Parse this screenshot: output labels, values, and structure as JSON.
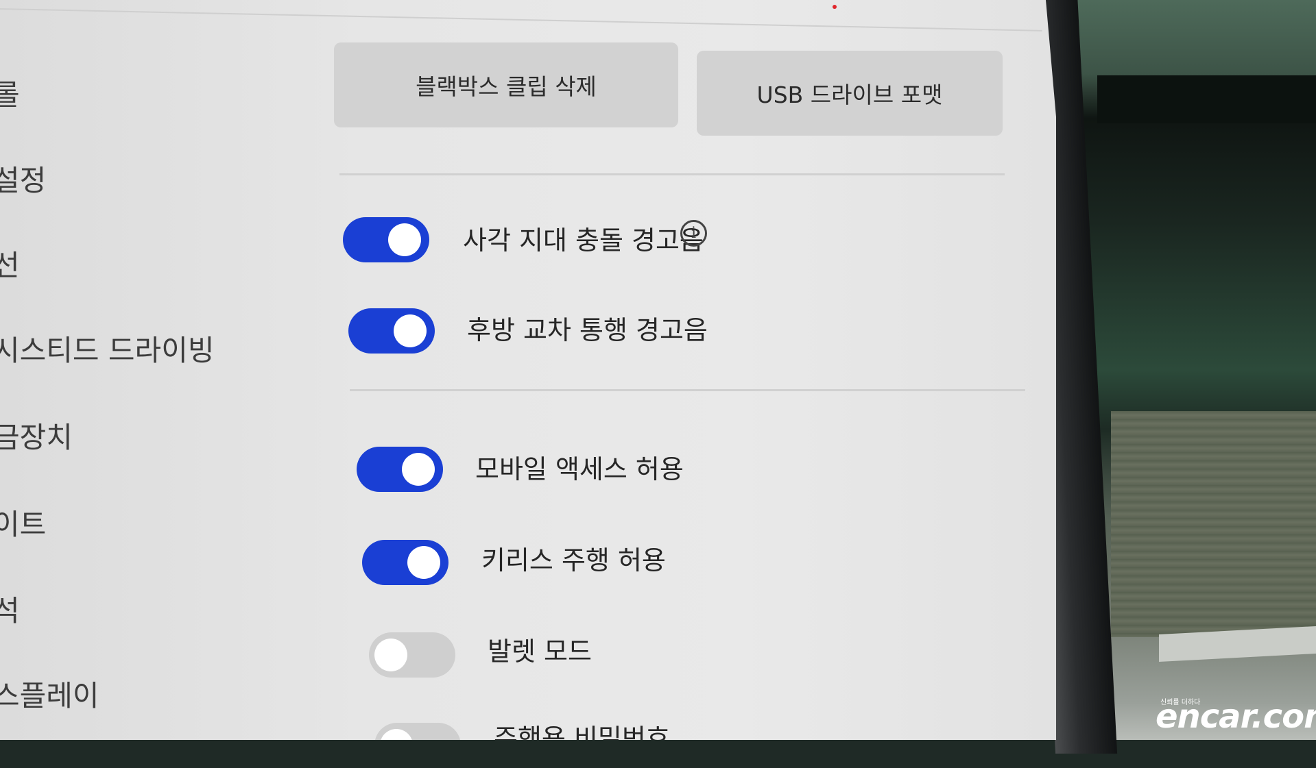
{
  "sidebar": {
    "items": [
      {
        "label": "롤"
      },
      {
        "label": "설정"
      },
      {
        "label": "선"
      },
      {
        "label": "시스티드 드라이빙"
      },
      {
        "label": "금장치"
      },
      {
        "label": "이트"
      },
      {
        "label": "석"
      },
      {
        "label": "스플레이"
      }
    ]
  },
  "actions": {
    "clip_delete": "블랙박스 클립 삭제",
    "usb_format": "USB 드라이브 포맷"
  },
  "toggles": [
    {
      "label": "사각 지대 충돌 경고음",
      "state": "on",
      "has_info": true
    },
    {
      "label": "후방 교차 통행 경고음",
      "state": "on"
    },
    {
      "label": "모바일 액세스 허용",
      "state": "on"
    },
    {
      "label": "키리스 주행 허용",
      "state": "on"
    },
    {
      "label": "발렛 모드",
      "state": "off"
    },
    {
      "label": "주행용 비밀번호",
      "state": "off"
    }
  ],
  "icons": {
    "info": "info-icon"
  },
  "colors": {
    "toggle_on": "#1a3fd4",
    "toggle_off": "#cfcfcf"
  },
  "watermark": {
    "brand": "encar.com",
    "tagline": "신뢰를 더하다"
  }
}
